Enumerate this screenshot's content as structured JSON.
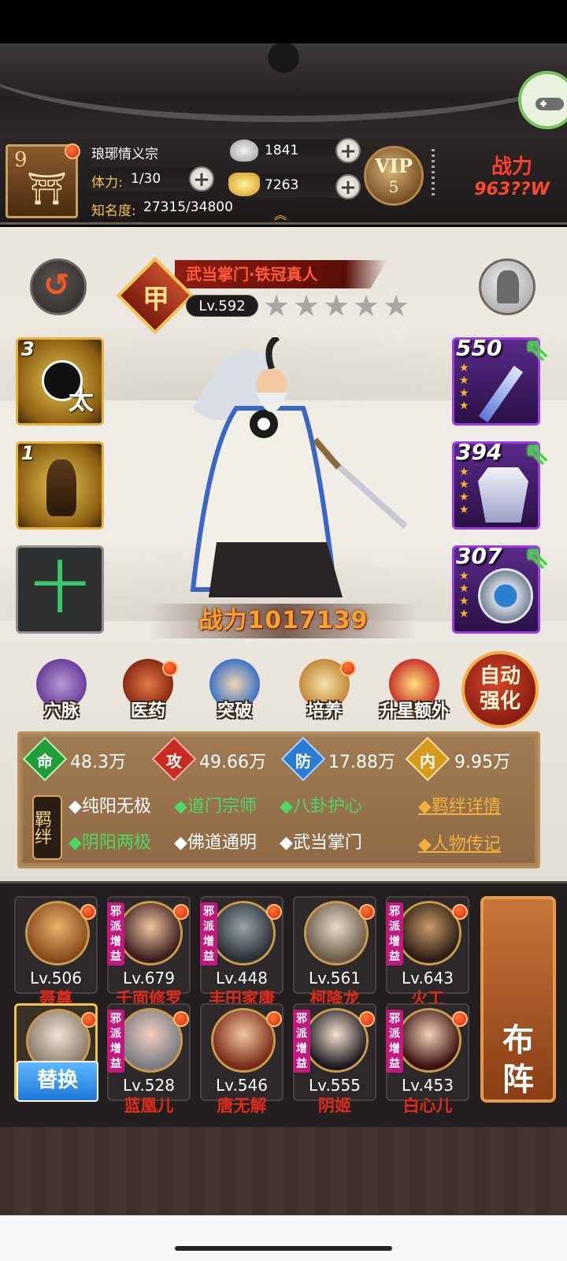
{
  "header": {
    "player_level": "9",
    "guild_name": "琅琊情义宗",
    "stamina_label": "体力:",
    "stamina_value": "1/30",
    "fame_label": "知名度:",
    "fame_value": "27315/34800",
    "silver": "1841",
    "gold": "7263",
    "vip_label": "VIP",
    "vip_level": "5",
    "power_label": "战力",
    "power_value": "963??W"
  },
  "hero": {
    "title": "武当掌门·铁冠真人",
    "rank_glyph": "甲",
    "level": "Lv.592",
    "stars_filled": 0,
    "stars_total": 5,
    "power": "战力1017139"
  },
  "skills": [
    {
      "level": "3",
      "glyph": "太"
    },
    {
      "level": "1",
      "glyph": ""
    },
    {
      "add": "十"
    }
  ],
  "equipment": [
    {
      "level": "550",
      "stars": 4,
      "icon": "sword-icon"
    },
    {
      "level": "394",
      "stars": 4,
      "icon": "robe-icon"
    },
    {
      "level": "307",
      "stars": 4,
      "icon": "taiji-shield-icon"
    }
  ],
  "functions": [
    {
      "label": "穴脉",
      "icon": "meridian-icon",
      "dot": false
    },
    {
      "label": "医药",
      "icon": "medicine-icon",
      "dot": true
    },
    {
      "label": "突破",
      "icon": "breakthrough-icon",
      "dot": false
    },
    {
      "label": "培养",
      "icon": "scroll-icon",
      "dot": true
    },
    {
      "label": "升星额外",
      "icon": "star-up-icon",
      "dot": false
    }
  ],
  "auto_button": {
    "line1": "自动",
    "line2": "强化"
  },
  "stats": {
    "hp": {
      "glyph": "命",
      "value": "48.3万",
      "color": "#1f9e3a"
    },
    "atk": {
      "glyph": "攻",
      "value": "49.66万",
      "color": "#c92a22"
    },
    "def": {
      "glyph": "防",
      "value": "17.88万",
      "color": "#2c7bd4"
    },
    "inner": {
      "glyph": "内",
      "value": "9.95万",
      "color": "#d49a1c"
    }
  },
  "bonds": {
    "label": "羁绊",
    "row1": [
      {
        "text": "◆纯阳无极",
        "active": false
      },
      {
        "text": "◆道门宗师",
        "active": true
      },
      {
        "text": "◆八卦护心",
        "active": true
      }
    ],
    "row2": [
      {
        "text": "◆阴阳两极",
        "active": true
      },
      {
        "text": "◆佛道通明",
        "active": false
      },
      {
        "text": "◆武当掌门",
        "active": false
      }
    ],
    "detail_link": "◆羁绊详情",
    "bio_link": "◆人物传记"
  },
  "roster": {
    "tag": "邪派增益",
    "swap_label": "替换",
    "formation_label1": "布",
    "formation_label2": "阵",
    "row1": [
      {
        "lv": "Lv.506",
        "name": "聂尊",
        "tag": false
      },
      {
        "lv": "Lv.679",
        "name": "千面修罗",
        "tag": true
      },
      {
        "lv": "Lv.448",
        "name": "丰田家康",
        "tag": true
      },
      {
        "lv": "Lv.561",
        "name": "柯降龙",
        "tag": false
      },
      {
        "lv": "Lv.643",
        "name": "火工",
        "tag": true
      }
    ],
    "row2": [
      {
        "lv": "",
        "name": "",
        "tag": false
      },
      {
        "lv": "Lv.528",
        "name": "蓝凰儿",
        "tag": true
      },
      {
        "lv": "Lv.546",
        "name": "唐无解",
        "tag": false
      },
      {
        "lv": "Lv.555",
        "name": "阴姬",
        "tag": true
      },
      {
        "lv": "Lv.453",
        "name": "白心儿",
        "tag": true
      }
    ]
  }
}
